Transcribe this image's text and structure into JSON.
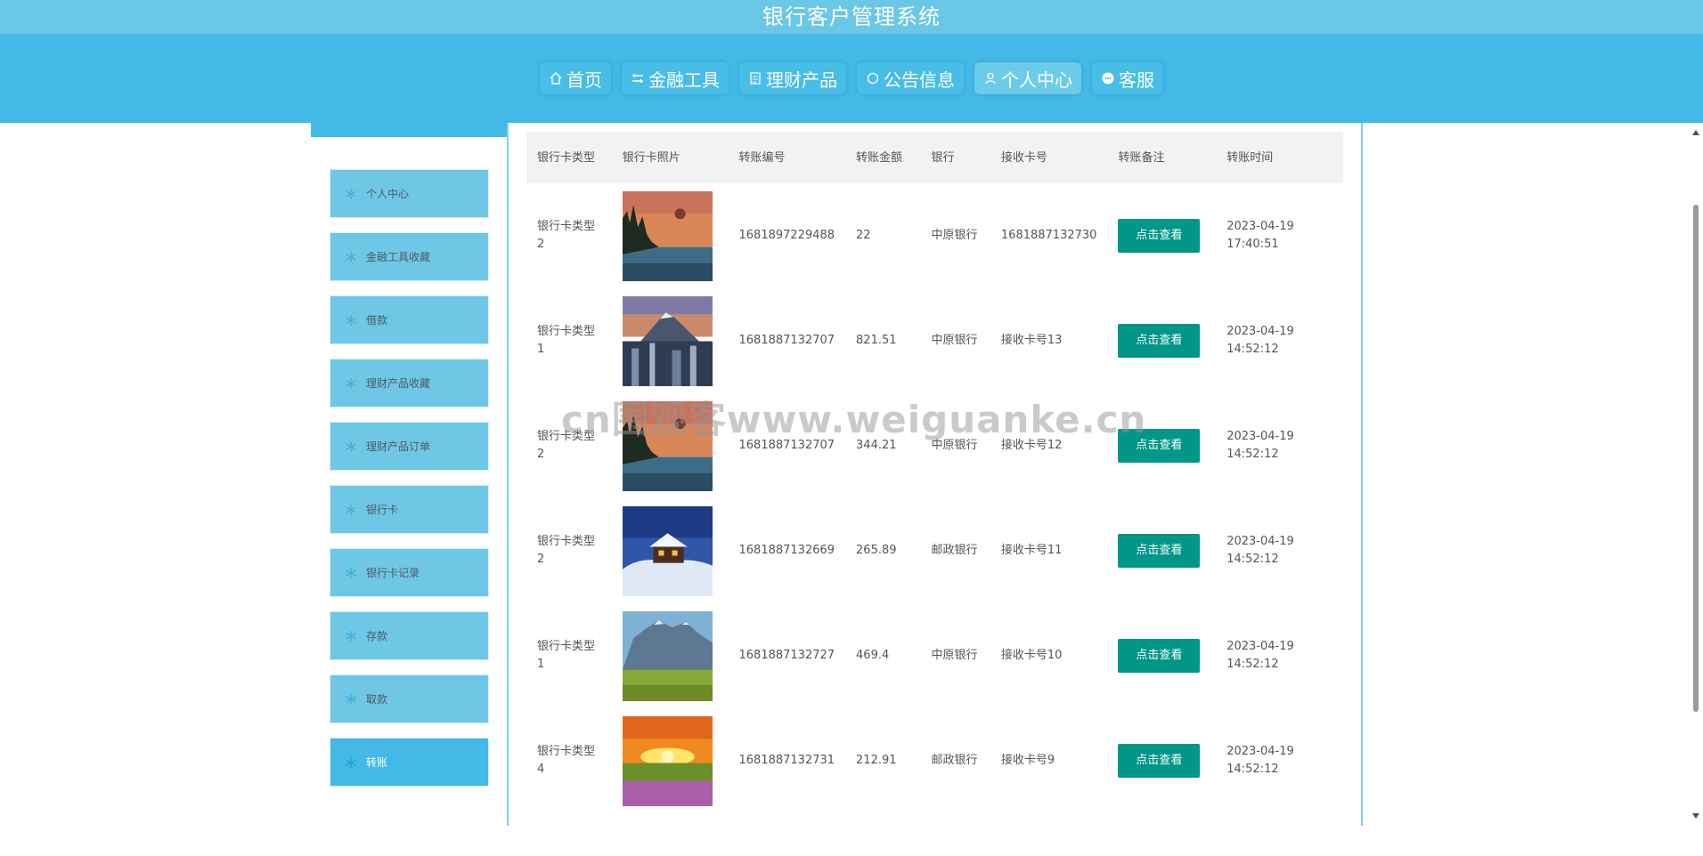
{
  "header": {
    "title": "银行客户管理系统"
  },
  "nav": {
    "items": [
      {
        "label": "首页",
        "icon": "home-icon"
      },
      {
        "label": "金融工具",
        "icon": "sliders-icon"
      },
      {
        "label": "理财产品",
        "icon": "document-icon"
      },
      {
        "label": "公告信息",
        "icon": "circle-icon"
      },
      {
        "label": "个人中心",
        "icon": "user-icon",
        "active": true
      },
      {
        "label": "客服",
        "icon": "chat-icon"
      }
    ]
  },
  "sidebar": {
    "items": [
      {
        "label": "个人中心"
      },
      {
        "label": "金融工具收藏"
      },
      {
        "label": "借款"
      },
      {
        "label": "理财产品收藏"
      },
      {
        "label": "理财产品订单"
      },
      {
        "label": "银行卡"
      },
      {
        "label": "银行卡记录"
      },
      {
        "label": "存款"
      },
      {
        "label": "取款"
      },
      {
        "label": "转账",
        "active": true
      }
    ]
  },
  "table": {
    "headers": [
      "银行卡类型",
      "银行卡照片",
      "转账编号",
      "转账金额",
      "银行",
      "接收卡号",
      "转账备注",
      "转账时间"
    ],
    "rows": [
      {
        "card_type": "银行卡类型2",
        "photo": "lake-sunset",
        "transfer_no": "1681897229488",
        "amount": "22",
        "bank": "中原银行",
        "card_no": "1681887132730",
        "remark": "点击查看",
        "time": "2023-04-19 17:40:51"
      },
      {
        "card_type": "银行卡类型1",
        "photo": "mountain-city",
        "transfer_no": "1681887132707",
        "amount": "821.51",
        "bank": "中原银行",
        "card_no": "接收卡号13",
        "remark": "点击查看",
        "time": "2023-04-19 14:52:12"
      },
      {
        "card_type": "银行卡类型2",
        "photo": "lake-sunset",
        "transfer_no": "1681887132707",
        "amount": "344.21",
        "bank": "中原银行",
        "card_no": "接收卡号12",
        "remark": "点击查看",
        "time": "2023-04-19 14:52:12"
      },
      {
        "card_type": "银行卡类型2",
        "photo": "snow-cabin",
        "transfer_no": "1681887132669",
        "amount": "265.89",
        "bank": "邮政银行",
        "card_no": "接收卡号11",
        "remark": "点击查看",
        "time": "2023-04-19 14:52:12"
      },
      {
        "card_type": "银行卡类型1",
        "photo": "mountain-meadow",
        "transfer_no": "1681887132727",
        "amount": "469.4",
        "bank": "中原银行",
        "card_no": "接收卡号10",
        "remark": "点击查看",
        "time": "2023-04-19 14:52:12"
      },
      {
        "card_type": "银行卡类型4",
        "photo": "flower-sunrise",
        "transfer_no": "1681887132731",
        "amount": "212.91",
        "bank": "邮政银行",
        "card_no": "接收卡号9",
        "remark": "点击查看",
        "time": "2023-04-19 14:52:12"
      }
    ]
  },
  "watermark": {
    "text": "cn围观客www.weiguanke.cn"
  },
  "colors": {
    "header": "#6ac8e6",
    "nav_band": "#42b9e7",
    "sidebar_item": "#6ec7e4",
    "sidebar_active": "#42b9e7",
    "button": "#009688"
  }
}
